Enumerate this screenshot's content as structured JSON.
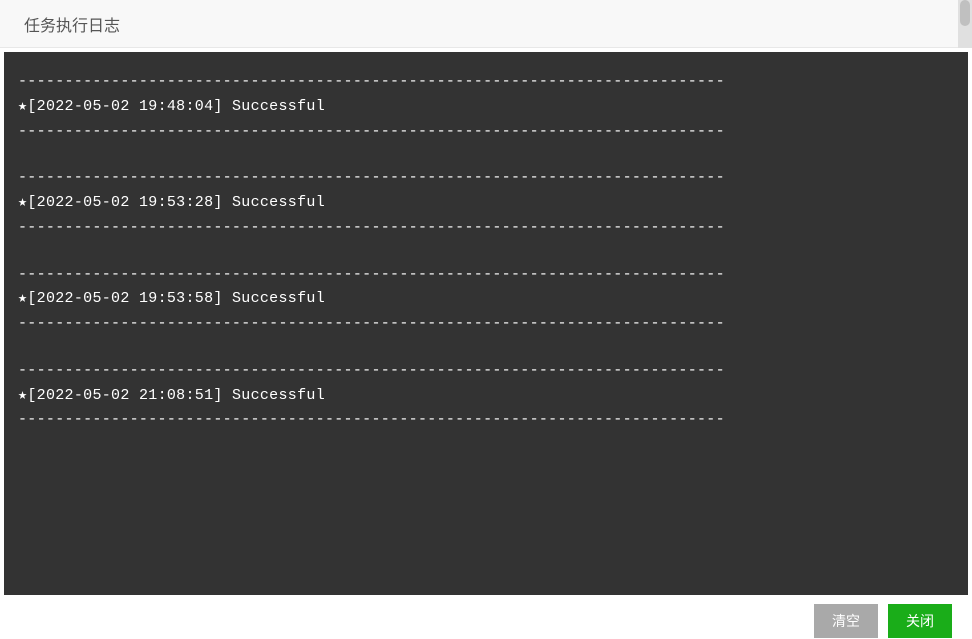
{
  "header": {
    "title": "任务执行日志"
  },
  "log": {
    "separator": "----------------------------------------------------------------------------",
    "star_symbol": "★",
    "entries": [
      {
        "timestamp": "2022-05-02 19:48:04",
        "status": "Successful"
      },
      {
        "timestamp": "2022-05-02 19:53:28",
        "status": "Successful"
      },
      {
        "timestamp": "2022-05-02 19:53:58",
        "status": "Successful"
      },
      {
        "timestamp": "2022-05-02 21:08:51",
        "status": "Successful"
      }
    ]
  },
  "footer": {
    "clear_label": "清空",
    "close_label": "关闭"
  }
}
